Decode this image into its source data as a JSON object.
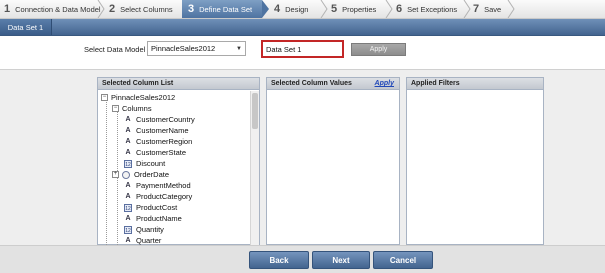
{
  "wizard": {
    "steps": [
      {
        "num": "1",
        "label": "Connection & Data Model"
      },
      {
        "num": "2",
        "label": "Select Columns"
      },
      {
        "num": "3",
        "label": "Define Data Set"
      },
      {
        "num": "4",
        "label": "Design"
      },
      {
        "num": "5",
        "label": "Properties"
      },
      {
        "num": "6",
        "label": "Set Exceptions"
      },
      {
        "num": "7",
        "label": "Save"
      }
    ]
  },
  "tabs": {
    "active": "Data Set 1"
  },
  "model": {
    "label": "Select Data Model",
    "selected": "PinnacleSales2012",
    "dataset_name": "Data Set 1",
    "apply_label": "Apply"
  },
  "panels": {
    "columns": {
      "title": "Selected Column List"
    },
    "values": {
      "title": "Selected Column Values",
      "link": "Apply"
    },
    "filters": {
      "title": "Applied Filters"
    }
  },
  "tree": {
    "root": "PinnacleSales2012",
    "group": "Columns",
    "items": [
      {
        "label": "CustomerCountry",
        "icon": "text-icon"
      },
      {
        "label": "CustomerName",
        "icon": "text-icon"
      },
      {
        "label": "CustomerRegion",
        "icon": "text-icon"
      },
      {
        "label": "CustomerState",
        "icon": "text-icon"
      },
      {
        "label": "Discount",
        "icon": "numeric-icon"
      },
      {
        "label": "OrderDate",
        "icon": "date-icon"
      },
      {
        "label": "PaymentMethod",
        "icon": "text-icon"
      },
      {
        "label": "ProductCategory",
        "icon": "text-icon"
      },
      {
        "label": "ProductCost",
        "icon": "numeric-icon"
      },
      {
        "label": "ProductName",
        "icon": "text-icon"
      },
      {
        "label": "Quantity",
        "icon": "numeric-icon"
      },
      {
        "label": "Quarter",
        "icon": "text-icon"
      }
    ]
  },
  "footer": {
    "back": "Back",
    "next": "Next",
    "cancel": "Cancel"
  },
  "colors": {
    "accent": "#4e73a1",
    "highlight_border": "#c32626",
    "link": "#2048b8"
  }
}
